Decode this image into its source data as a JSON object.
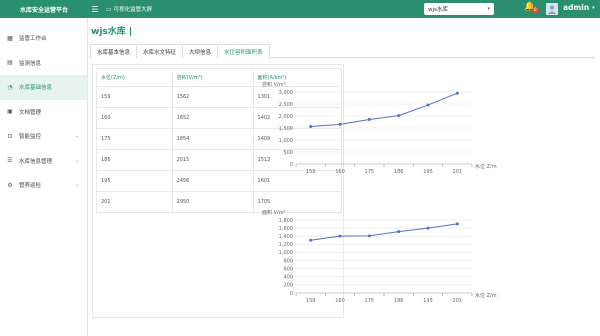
{
  "app": {
    "title": "水库安全运营平台",
    "bigscreen_label": "可视化监管大屏"
  },
  "header": {
    "reservoir_select": "wjs水库",
    "notification_count": "0",
    "username": "admin"
  },
  "sidebar": {
    "items": [
      {
        "label": "监管工作台"
      },
      {
        "label": "监测信息"
      },
      {
        "label": "水库基础信息"
      },
      {
        "label": "文档管理"
      },
      {
        "label": "智能监控"
      },
      {
        "label": "水库信息管理"
      },
      {
        "label": "管养巡检"
      }
    ]
  },
  "page": {
    "title": "wjs水库 |"
  },
  "tabs": [
    {
      "label": "水库基本信息"
    },
    {
      "label": "水库水文特征"
    },
    {
      "label": "大坝信息"
    },
    {
      "label": "水位容积面积表"
    }
  ],
  "table": {
    "headers": [
      "水位(Z/m)",
      "容积(V/m³)",
      "面积(A/km²)"
    ],
    "rows": [
      [
        "159",
        "1562",
        "1301"
      ],
      [
        "160",
        "1652",
        "1402"
      ],
      [
        "175",
        "1854",
        "1409"
      ],
      [
        "186",
        "2015",
        "1513"
      ],
      [
        "195",
        "2456",
        "1601"
      ],
      [
        "201",
        "2950",
        "1705"
      ]
    ]
  },
  "chart_data": [
    {
      "type": "line",
      "ylabel": "容积 V/m³",
      "xlabel": "水位 Z/m",
      "categories": [
        "159",
        "160",
        "175",
        "186",
        "195",
        "201"
      ],
      "values": [
        1562,
        1652,
        1854,
        2015,
        2456,
        2950
      ],
      "ylim": [
        0,
        3000
      ],
      "yticks": [
        0,
        500,
        1000,
        1500,
        2000,
        2500,
        3000
      ],
      "ytick_labels": [
        "0",
        "500",
        "1,000",
        "1,500",
        "2,000",
        "2,500",
        "3,000"
      ],
      "color": "#5470c6"
    },
    {
      "type": "line",
      "ylabel": "面积 V/m²",
      "xlabel": "水位 Z/m",
      "categories": [
        "159",
        "160",
        "175",
        "186",
        "195",
        "201"
      ],
      "values": [
        1301,
        1402,
        1409,
        1513,
        1601,
        1705
      ],
      "ylim": [
        0,
        1800
      ],
      "yticks": [
        0,
        200,
        400,
        600,
        800,
        1000,
        1200,
        1400,
        1600,
        1800
      ],
      "ytick_labels": [
        "0",
        "200",
        "400",
        "600",
        "800",
        "1,000",
        "1,200",
        "1,400",
        "1,600",
        "1,800"
      ],
      "color": "#5470c6"
    }
  ],
  "colors": {
    "brand": "#2a8f6e",
    "accent_line": "#5470c6",
    "badge": "#e74c3c"
  }
}
